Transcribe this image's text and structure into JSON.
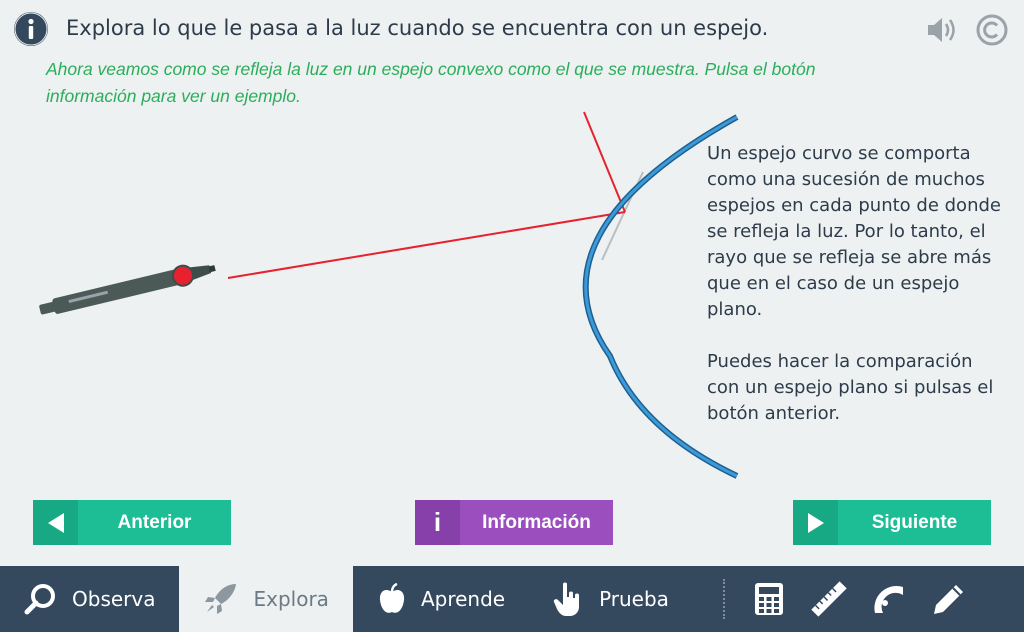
{
  "header": {
    "title": "Explora lo que le pasa a la luz cuando se encuentra con un espejo.",
    "subtitle": "Ahora veamos como se refleja la luz en un espejo convexo como el que se muestra. Pulsa el botón información para ver un ejemplo."
  },
  "explanation": {
    "paragraph1": "Un espejo curvo se comporta como una sucesión de muchos espejos en cada punto de donde se refleja la luz. Por lo tanto, el rayo que se refleja se abre más que en el caso de un espejo plano.",
    "paragraph2": "Puedes hacer la comparación con un espejo plano si pulsas el botón anterior."
  },
  "buttons": {
    "prev": "Anterior",
    "info_icon": "i",
    "info": "Información",
    "next": "Siguiente"
  },
  "nav": {
    "items": [
      {
        "label": "Observa",
        "icon": "magnifier-icon"
      },
      {
        "label": "Explora",
        "icon": "rocket-icon"
      },
      {
        "label": "Aprende",
        "icon": "apple-icon"
      },
      {
        "label": "Prueba",
        "icon": "hand-pointer-icon"
      }
    ],
    "active": "Explora",
    "tools": [
      "calculator-icon",
      "ruler-icon",
      "protractor-icon",
      "pencil-icon"
    ]
  },
  "colors": {
    "accent_green": "#1dbe96",
    "info_purple": "#9b4fbe",
    "subtitle_green": "#2bae5a",
    "nav_bg": "#34495e",
    "mirror_blue": "#2f86c8",
    "laser_red": "#e8212e"
  }
}
